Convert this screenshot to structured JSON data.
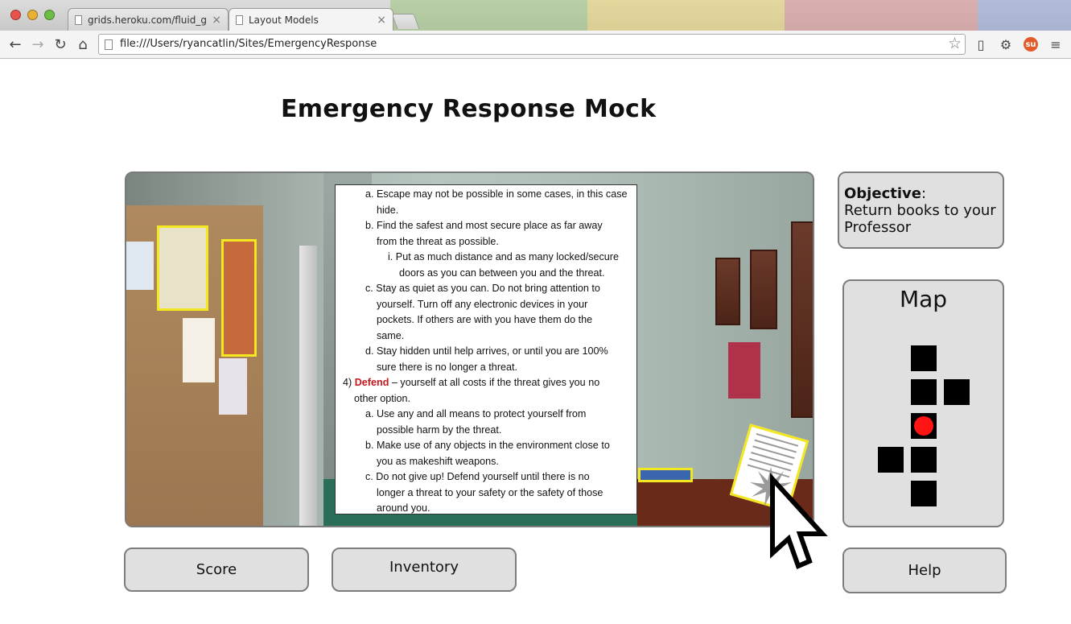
{
  "browser": {
    "tabs": [
      {
        "title": "grids.heroku.com/fluid_grid",
        "active": false
      },
      {
        "title": "Layout Models",
        "active": true
      }
    ],
    "url": "file:///Users/ryancatlin/Sites/EmergencyResponse"
  },
  "page": {
    "title": "Emergency Response Mock"
  },
  "scene": {
    "document_lines": [
      "a.  Escape may not be possible in some cases, in this case",
      "hide.",
      "b.  Find the safest and most secure place as far away",
      "from the threat as possible.",
      "i.   Put as much distance and as many locked/secure",
      "doors as you can between you and the threat.",
      "c.  Stay as quiet as you can. Do not bring attention to",
      "yourself. Turn off any electronic devices in your",
      "pockets. If others are with you have them do the",
      "same.",
      "d.  Stay hidden until help arrives, or until you are 100%",
      "sure there is no longer a threat.",
      "4) ",
      "Defend",
      " – yourself at all costs if the threat gives you no",
      "other option.",
      "a.  Use any and all means to protect yourself from",
      "possible harm by the threat.",
      "b.  Make use of any objects in the environment close to",
      "you as makeshift weapons.",
      "c.  Do not give up! Defend yourself until there is no",
      "longer a threat to your safety or the safety of those",
      "around you."
    ],
    "highlight_color": "#f3e81f"
  },
  "objective": {
    "label": "Objective",
    "colon": ":",
    "text": "Return books to your Professor"
  },
  "map": {
    "title": "Map",
    "player_color": "#ff1313"
  },
  "buttons": {
    "score": "Score",
    "inventory": "Inventory",
    "help": "Help"
  }
}
